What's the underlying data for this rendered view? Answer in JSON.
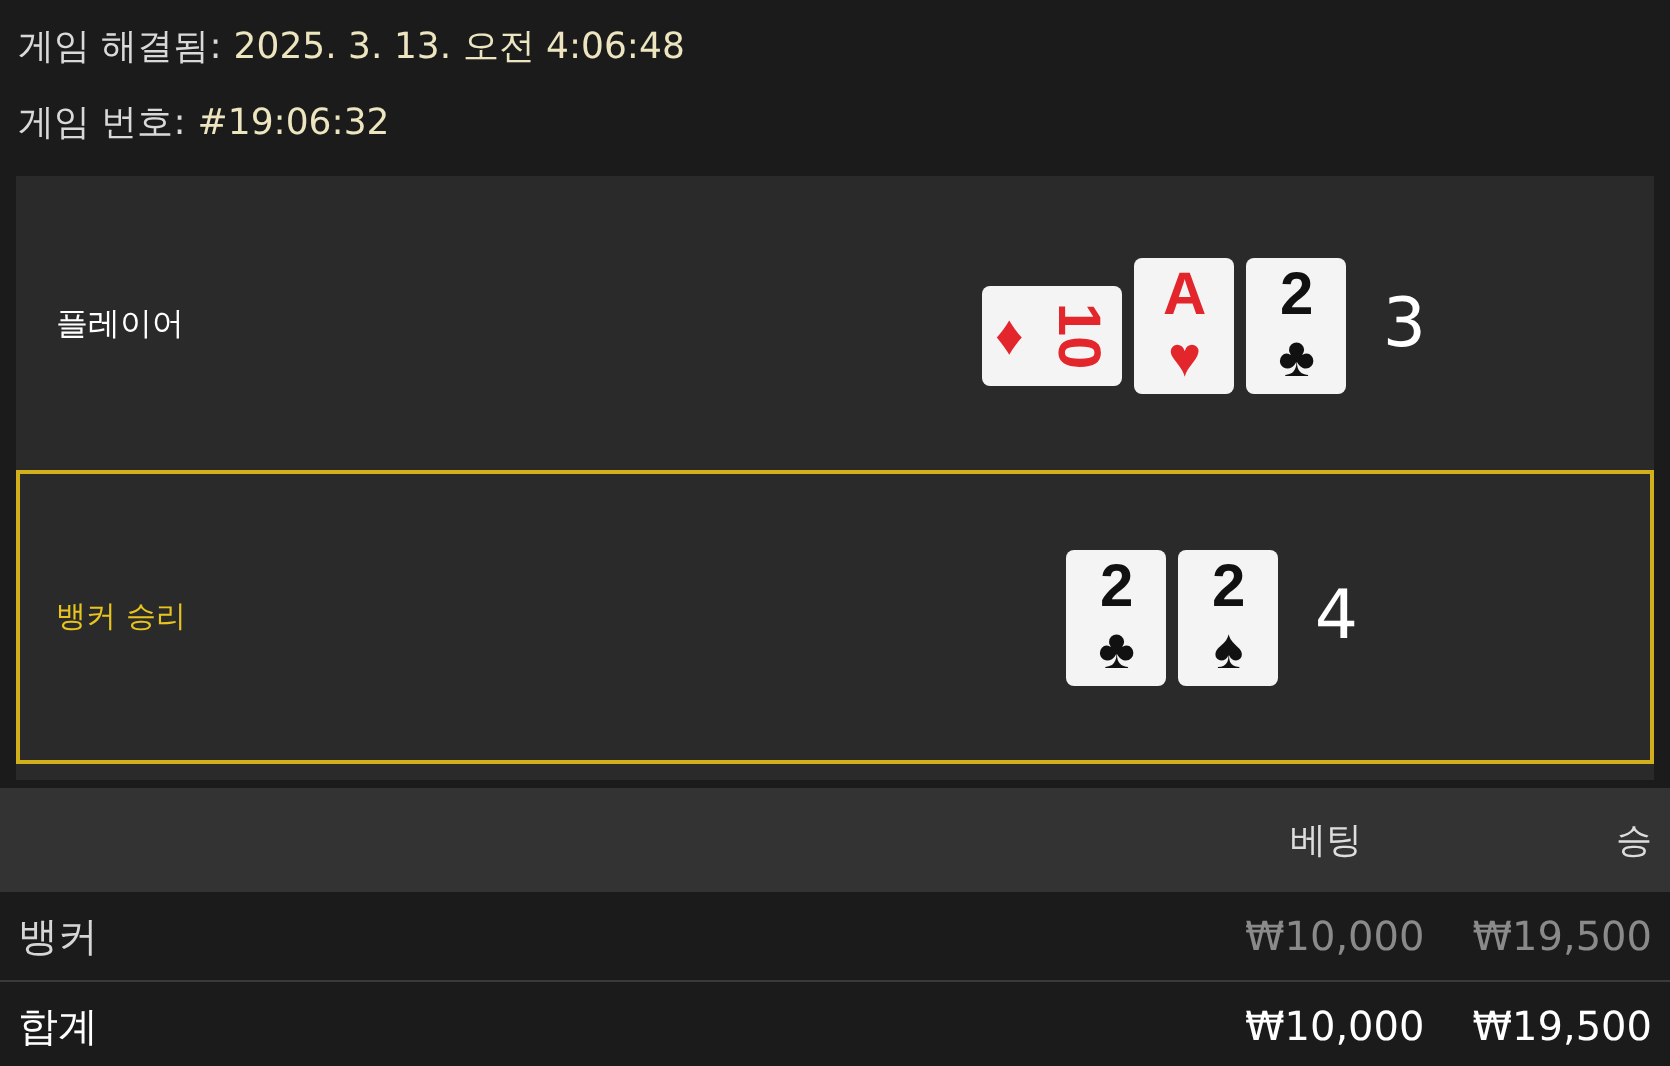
{
  "header": [
    {
      "label": "게임 해결됨:",
      "value": "2025. 3. 13. 오전 4:06:48"
    },
    {
      "label": "게임 번호:",
      "value": "#19:06:32"
    }
  ],
  "hands": [
    {
      "label": "플레이어",
      "winner": false,
      "total": "3",
      "cards": [
        {
          "rank": "10",
          "suit": "♦",
          "color": "#e3262b",
          "sideways": true
        },
        {
          "rank": "A",
          "suit": "♥",
          "color": "#e3262b",
          "sideways": false
        },
        {
          "rank": "2",
          "suit": "♣",
          "color": "#111111",
          "sideways": false
        }
      ]
    },
    {
      "label": "뱅커 승리",
      "winner": true,
      "total": "4",
      "cards": [
        {
          "rank": "2",
          "suit": "♣",
          "color": "#111111",
          "sideways": false
        },
        {
          "rank": "2",
          "suit": "♠",
          "color": "#111111",
          "sideways": false
        }
      ]
    }
  ],
  "table": {
    "columns": [
      "베팅",
      "승"
    ],
    "rows": [
      {
        "label": "뱅커",
        "bet": "₩10,000",
        "win": "₩19,500",
        "kind": "bet"
      },
      {
        "label": "합계",
        "bet": "₩10,000",
        "win": "₩19,500",
        "kind": "total"
      }
    ]
  }
}
